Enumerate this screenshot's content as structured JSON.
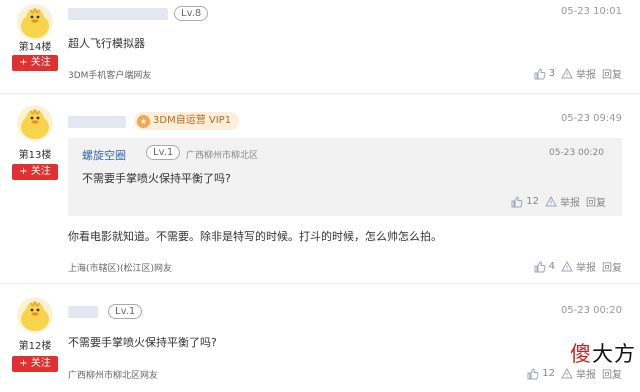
{
  "comments": [
    {
      "floor": "第14楼",
      "follow_label": "+ 关注",
      "level": "Lv.8",
      "time": "05-23 10:01",
      "text": "超人飞行模拟器",
      "from": "3DM手机客户端网友",
      "likes": "3",
      "report": "举报",
      "reply": "回复"
    },
    {
      "floor": "第13楼",
      "follow_label": "+ 关注",
      "vip": "3DM自运营 VIP1",
      "time": "05-23 09:49",
      "quote": {
        "user": "螺旋空圈",
        "level": "Lv.1",
        "location": "广西柳州市柳北区",
        "time": "05-23 00:20",
        "text": "不需要手掌喷火保持平衡了吗?",
        "likes": "12",
        "report": "举报",
        "reply": "回复"
      },
      "text": "你看电影就知道。不需要。除非是特写的时候。打斗的时候，怎么帅怎么拍。",
      "from": "上海(市辖区)(松江区)网友",
      "likes": "4",
      "report": "举报",
      "reply": "回复"
    },
    {
      "floor": "第12楼",
      "follow_label": "+ 关注",
      "level": "Lv.1",
      "time": "05-23 00:20",
      "text": "不需要手掌喷火保持平衡了吗?",
      "from": "广西柳州市柳北区网友",
      "likes": "12",
      "report": "举报",
      "reply": "回复"
    }
  ],
  "watermark": {
    "part1": "傻",
    "part2": "大方"
  }
}
